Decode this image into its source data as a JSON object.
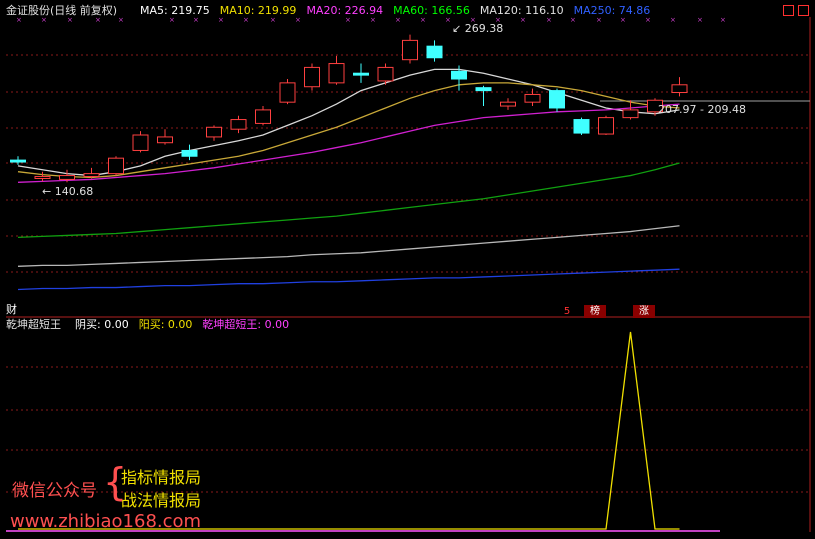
{
  "header": {
    "title": "金证股份(日线 前复权)",
    "ma_items": [
      {
        "label": "MA5: 219.75",
        "color": "#ffffff"
      },
      {
        "label": "MA10: 219.99",
        "color": "#f0e000"
      },
      {
        "label": "MA20: 226.94",
        "color": "#ff40ff"
      },
      {
        "label": "MA60: 166.56",
        "color": "#00ff00"
      },
      {
        "label": "MA120: 116.10",
        "color": "#e0e0e0"
      },
      {
        "label": "MA250: 74.86",
        "color": "#3060ff"
      }
    ]
  },
  "main_chart": {
    "price_high_label": "269.38",
    "price_low_label": "140.68",
    "range_label": "207.97 - 209.48",
    "fin_marker": "财",
    "events": [
      {
        "text": "5",
        "color": "#ff3030"
      },
      {
        "text": "榜",
        "color": "#ffffff"
      },
      {
        "text": "涨",
        "color": "#ffffff"
      }
    ],
    "candles": [
      {
        "o": 168,
        "c": 166,
        "h": 172,
        "l": 163
      },
      {
        "o": 150,
        "c": 150,
        "h": 156,
        "l": 146
      },
      {
        "o": 148,
        "c": 152,
        "h": 158,
        "l": 145
      },
      {
        "o": 151,
        "c": 154,
        "h": 160,
        "l": 149
      },
      {
        "o": 154,
        "c": 170,
        "h": 172,
        "l": 152
      },
      {
        "o": 178,
        "c": 194,
        "h": 198,
        "l": 176
      },
      {
        "o": 186,
        "c": 192,
        "h": 200,
        "l": 184
      },
      {
        "o": 178,
        "c": 172,
        "h": 184,
        "l": 168
      },
      {
        "o": 192,
        "c": 202,
        "h": 204,
        "l": 188
      },
      {
        "o": 200,
        "c": 210,
        "h": 214,
        "l": 196
      },
      {
        "o": 206,
        "c": 220,
        "h": 224,
        "l": 204
      },
      {
        "o": 228,
        "c": 248,
        "h": 252,
        "l": 226
      },
      {
        "o": 244,
        "c": 264,
        "h": 268,
        "l": 240
      },
      {
        "o": 248,
        "c": 268,
        "h": 276,
        "l": 246
      },
      {
        "o": 258,
        "c": 256,
        "h": 268,
        "l": 248
      },
      {
        "o": 250,
        "c": 264,
        "h": 268,
        "l": 246
      },
      {
        "o": 272,
        "c": 292,
        "h": 298,
        "l": 268
      },
      {
        "o": 286,
        "c": 274,
        "h": 292,
        "l": 270
      },
      {
        "o": 260,
        "c": 252,
        "h": 266,
        "l": 240
      },
      {
        "o": 242,
        "c": 241,
        "h": 245,
        "l": 224
      },
      {
        "o": 224,
        "c": 228,
        "h": 232,
        "l": 220
      },
      {
        "o": 228,
        "c": 236,
        "h": 242,
        "l": 224
      },
      {
        "o": 240,
        "c": 222,
        "h": 242,
        "l": 218
      },
      {
        "o": 210,
        "c": 196,
        "h": 212,
        "l": 194
      },
      {
        "o": 195,
        "c": 212,
        "h": 214,
        "l": 194
      },
      {
        "o": 212,
        "c": 220,
        "h": 230,
        "l": 210
      },
      {
        "o": 218,
        "c": 230,
        "h": 232,
        "l": 214
      },
      {
        "o": 238,
        "c": 246,
        "h": 254,
        "l": 234
      }
    ],
    "ma_series": [
      {
        "name": "MA5",
        "color": "#d8d8d8",
        "values": [
          162,
          158,
          154,
          152,
          156,
          162,
          172,
          178,
          183,
          188,
          194,
          204,
          214,
          226,
          240,
          248,
          256,
          262,
          262,
          258,
          252,
          246,
          238,
          230,
          222,
          218,
          216,
          220
        ]
      },
      {
        "name": "MA10",
        "color": "#c8a838",
        "values": [
          156,
          153,
          151,
          150,
          152,
          156,
          160,
          164,
          168,
          172,
          178,
          186,
          194,
          202,
          212,
          222,
          232,
          240,
          246,
          248,
          248,
          246,
          244,
          240,
          234,
          228,
          224,
          222
        ]
      },
      {
        "name": "MA20",
        "color": "#d020d0",
        "values": [
          145,
          146,
          147,
          148,
          150,
          152,
          154,
          157,
          160,
          164,
          168,
          172,
          176,
          181,
          186,
          192,
          198,
          204,
          208,
          212,
          214,
          216,
          218,
          219,
          220,
          222,
          224,
          226
        ]
      },
      {
        "name": "MA60",
        "color": "#10a010",
        "values": [
          88,
          89,
          90,
          91,
          92,
          94,
          96,
          98,
          100,
          102,
          104,
          106,
          108,
          110,
          113,
          116,
          119,
          122,
          125,
          128,
          132,
          136,
          140,
          144,
          148,
          152,
          158,
          165
        ]
      },
      {
        "name": "MA120",
        "color": "#b8b8b8",
        "values": [
          58,
          59,
          59,
          60,
          61,
          62,
          63,
          64,
          65,
          66,
          67,
          68,
          70,
          71,
          72,
          74,
          76,
          78,
          80,
          82,
          84,
          86,
          88,
          90,
          92,
          94,
          97,
          100
        ]
      },
      {
        "name": "MA250",
        "color": "#2040e0",
        "values": [
          34,
          35,
          35,
          36,
          36,
          37,
          38,
          38,
          39,
          40,
          40,
          41,
          42,
          42,
          43,
          44,
          45,
          46,
          46,
          47,
          48,
          49,
          50,
          51,
          52,
          53,
          54,
          55
        ]
      }
    ]
  },
  "indicator": {
    "title": "乾坤超短王",
    "items": [
      {
        "label": "阴买: 0.00",
        "color": "#ffffff"
      },
      {
        "label": "阳买: 0.00",
        "color": "#f0e000"
      },
      {
        "label": "乾坤超短王: 0.00",
        "color": "#ff40ff"
      }
    ],
    "values": [
      0,
      0,
      0,
      0,
      0,
      0,
      0,
      0,
      0,
      0,
      0,
      0,
      0,
      0,
      0,
      0,
      0,
      0,
      0,
      0,
      0,
      0,
      0,
      0,
      0,
      1,
      0,
      0
    ]
  },
  "watermark": {
    "left": "微信公众号",
    "brace": "{",
    "line1": "指标情报局",
    "line2": "战法情报局",
    "url": "www.zhibiao168.com"
  }
}
